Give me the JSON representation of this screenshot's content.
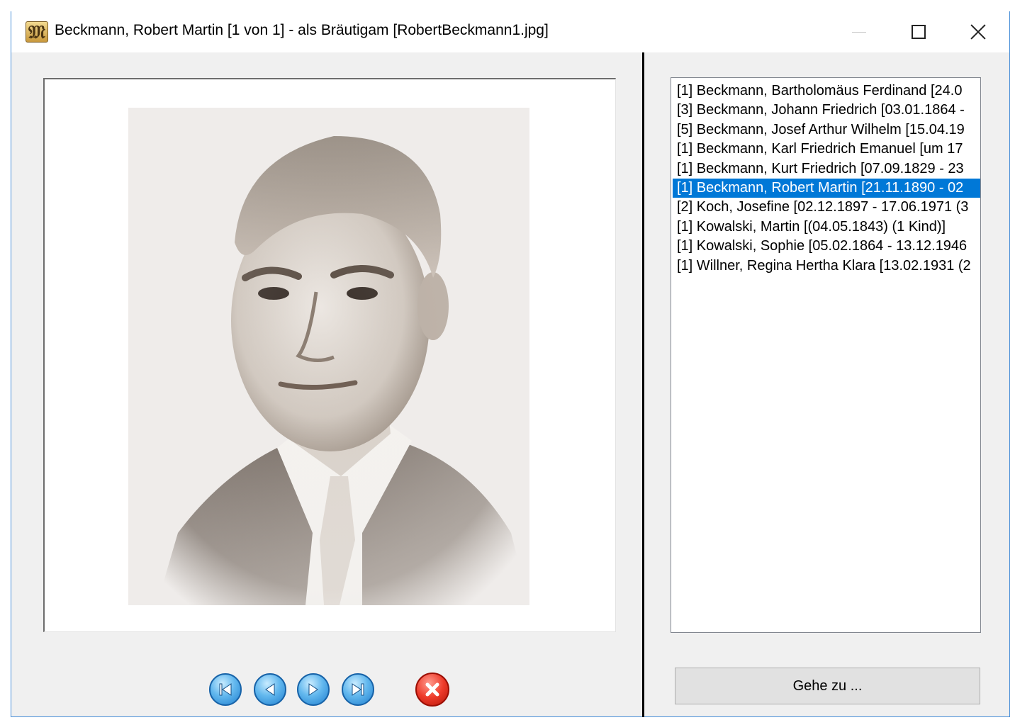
{
  "window": {
    "title": "Beckmann, Robert Martin [1 von 1] - als Bräutigam [RobertBeckmann1.jpg]",
    "icon": "app-logo-icon",
    "icon_glyph": "𝔐",
    "controls": {
      "minimize": "minimize-icon",
      "maximize": "maximize-icon",
      "close": "close-icon"
    }
  },
  "viewer": {
    "photo_subject": "Robert Martin Beckmann",
    "nav": {
      "first": "first-icon",
      "previous": "previous-icon",
      "next": "next-icon",
      "last": "last-icon",
      "close": "close-circle-icon"
    }
  },
  "people_list": {
    "items": [
      "[1] Beckmann, Bartholomäus Ferdinand [24.0",
      "[3] Beckmann, Johann Friedrich [03.01.1864 -",
      "[5] Beckmann, Josef Arthur Wilhelm [15.04.19",
      "[1] Beckmann, Karl Friedrich Emanuel [um 17",
      "[1] Beckmann, Kurt Friedrich [07.09.1829 - 23",
      "[1] Beckmann, Robert Martin [21.11.1890 - 02",
      "[2] Koch, Josefine [02.12.1897 - 17.06.1971 (3",
      "[1] Kowalski, Martin [(04.05.1843) (1 Kind)]",
      "[1] Kowalski, Sophie [05.02.1864 - 13.12.1946",
      "[1] Willner, Regina Hertha Klara [13.02.1931 (2"
    ],
    "selected_index": 5
  },
  "goto_button": {
    "label": "Gehe zu ..."
  },
  "colors": {
    "selection": "#0078d7",
    "window_bg": "#f0f0f0",
    "nav_blue": "#1f7fcf",
    "close_red": "#ee3b2b"
  }
}
